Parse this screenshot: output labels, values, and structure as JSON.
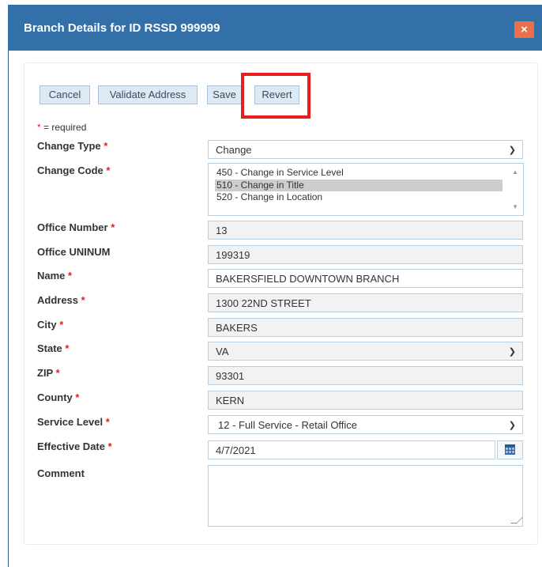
{
  "dialog": {
    "title": "Branch Details for ID RSSD 999999",
    "close_label": "×"
  },
  "toolbar": {
    "cancel_label": "Cancel",
    "validate_label": "Validate Address",
    "save_label": "Save",
    "revert_label": "Revert"
  },
  "required_note": {
    "star": "*",
    "text": "= required"
  },
  "form": {
    "change_type": {
      "label": "Change Type",
      "value": "Change"
    },
    "change_code": {
      "label": "Change Code",
      "options": [
        "450 - Change in Service Level",
        "510 - Change in Title",
        "520 - Change in Location"
      ],
      "selected_index": 1
    },
    "office_number": {
      "label": "Office Number",
      "value": "13"
    },
    "office_uninum": {
      "label": "Office UNINUM",
      "value": "199319"
    },
    "name": {
      "label": "Name",
      "value": "BAKERSFIELD DOWNTOWN BRANCH"
    },
    "address": {
      "label": "Address",
      "value": "1300 22ND STREET"
    },
    "city": {
      "label": "City",
      "value": "BAKERS"
    },
    "state": {
      "label": "State",
      "value": "VA"
    },
    "zip": {
      "label": "ZIP",
      "value": "93301"
    },
    "county": {
      "label": "County",
      "value": "KERN"
    },
    "service_level": {
      "label": "Service Level",
      "value": "12 - Full Service - Retail Office"
    },
    "effective_date": {
      "label": "Effective Date",
      "value": "4/7/2021"
    },
    "comment": {
      "label": "Comment",
      "value": ""
    }
  },
  "colors": {
    "titlebar": "#336fa8",
    "close_button": "#e8704a",
    "required_star": "#e02020",
    "highlight_box": "#e61e1e"
  }
}
